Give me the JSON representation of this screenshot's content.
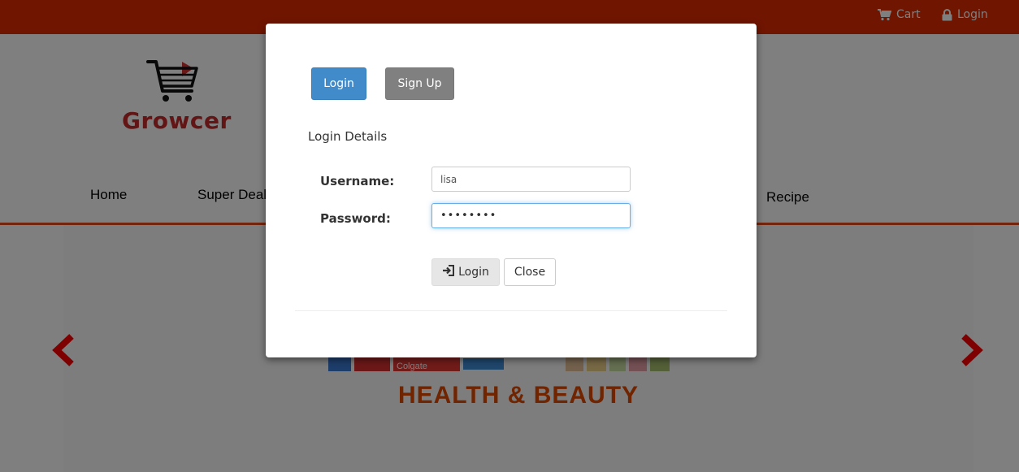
{
  "topbar": {
    "cart_label": "Cart",
    "login_label": "Login"
  },
  "header": {
    "logo_text": "Growcer",
    "nav": {
      "home": "Home",
      "super_deals": "Super Deal",
      "recipe": "Recipe"
    }
  },
  "banner": {
    "title": "HEALTH & BEAUTY",
    "product_label": "Colgate"
  },
  "modal": {
    "tab_login": "Login",
    "tab_signup": "Sign Up",
    "legend": "Login Details",
    "username_label": "Username:",
    "username_value": "lisa",
    "password_label": "Password:",
    "password_value": "••••••••",
    "login_button": "Login",
    "close_button": "Close"
  },
  "colors": {
    "topbar": "#e02a00",
    "brand_red": "#c62828",
    "primary": "#428bca",
    "secondary": "#808080",
    "banner_title": "#e04800"
  },
  "icons": {
    "cart": "cart-icon",
    "lock": "lock-icon",
    "sign_in": "sign-in-icon",
    "prev": "chevron-left-icon",
    "next": "chevron-right-icon"
  }
}
